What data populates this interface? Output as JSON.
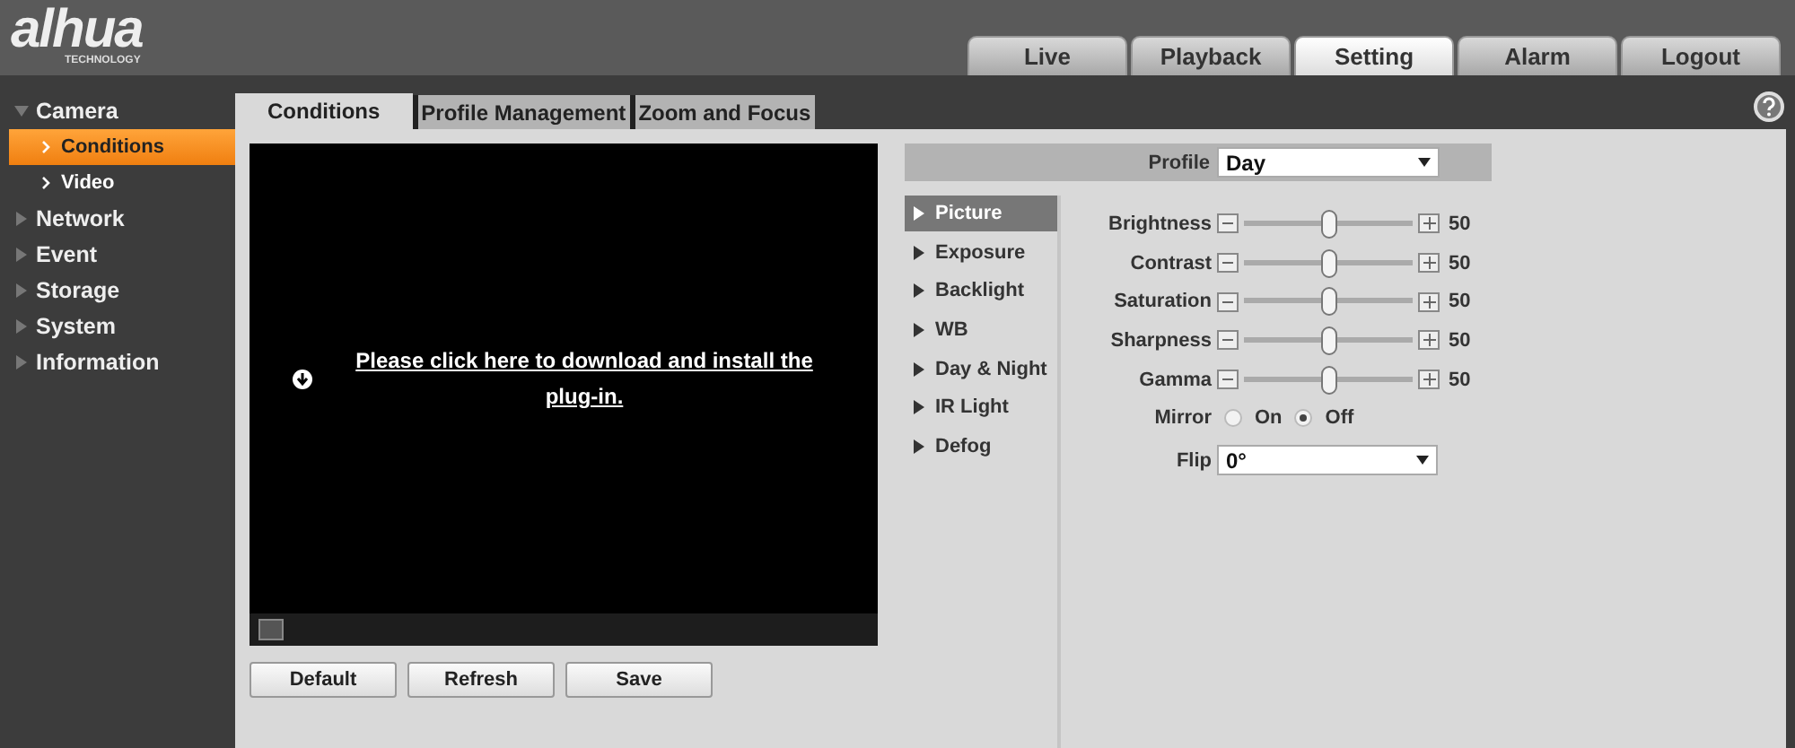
{
  "logo": {
    "text": "alhua",
    "tagline": "TECHNOLOGY"
  },
  "top_tabs": [
    {
      "label": "Live",
      "selected": false
    },
    {
      "label": "Playback",
      "selected": false
    },
    {
      "label": "Setting",
      "selected": true
    },
    {
      "label": "Alarm",
      "selected": false
    },
    {
      "label": "Logout",
      "selected": false
    }
  ],
  "sidebar": {
    "items": [
      {
        "label": "Camera",
        "expanded": true,
        "children": [
          {
            "label": "Conditions",
            "selected": true
          },
          {
            "label": "Video",
            "selected": false
          }
        ]
      },
      {
        "label": "Network",
        "expanded": false
      },
      {
        "label": "Event",
        "expanded": false
      },
      {
        "label": "Storage",
        "expanded": false
      },
      {
        "label": "System",
        "expanded": false
      },
      {
        "label": "Information",
        "expanded": false
      }
    ]
  },
  "sub_tabs": [
    {
      "label": "Conditions",
      "selected": true
    },
    {
      "label": "Profile Management",
      "selected": false
    },
    {
      "label": "Zoom and Focus",
      "selected": false
    }
  ],
  "video": {
    "message": "Please click here to download and install the plug-in."
  },
  "buttons": [
    "Default",
    "Refresh",
    "Save"
  ],
  "profile": {
    "label": "Profile",
    "value": "Day"
  },
  "categories": [
    {
      "label": "Picture",
      "selected": true
    },
    {
      "label": "Exposure",
      "selected": false
    },
    {
      "label": "Backlight",
      "selected": false
    },
    {
      "label": "WB",
      "selected": false
    },
    {
      "label": "Day & Night",
      "selected": false
    },
    {
      "label": "IR Light",
      "selected": false
    },
    {
      "label": "Defog",
      "selected": false
    }
  ],
  "settings": [
    {
      "kind": "slider",
      "label": "Brightness",
      "level": 0.5,
      "reading": "50"
    },
    {
      "kind": "slider",
      "label": "Contrast",
      "level": 0.5,
      "reading": "50"
    },
    {
      "kind": "slider",
      "label": "Saturation",
      "level": 0.5,
      "reading": "50"
    },
    {
      "kind": "slider",
      "label": "Sharpness",
      "level": 0.5,
      "reading": "50"
    },
    {
      "kind": "slider",
      "label": "Gamma",
      "level": 0.5,
      "reading": "50"
    },
    {
      "kind": "radio",
      "label": "Mirror",
      "options": [
        {
          "label": "On",
          "selected": false
        },
        {
          "label": "Off",
          "selected": true
        }
      ]
    },
    {
      "kind": "select",
      "label": "Flip",
      "value": "0°"
    }
  ]
}
